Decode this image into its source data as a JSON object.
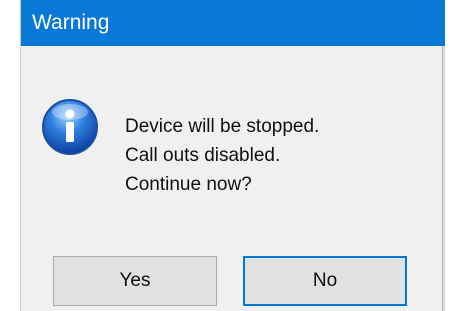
{
  "dialog": {
    "title": "Warning",
    "icon": "info-icon",
    "message": [
      "Device will be stopped.",
      "Call outs disabled.",
      "Continue now?"
    ],
    "buttons": {
      "yes_label": "Yes",
      "no_label": "No"
    }
  },
  "colors": {
    "titlebar": "#0a78d7",
    "dialog_bg": "#f0f0f0",
    "button_bg": "#e1e1e1",
    "focus_border": "#0078d7"
  }
}
